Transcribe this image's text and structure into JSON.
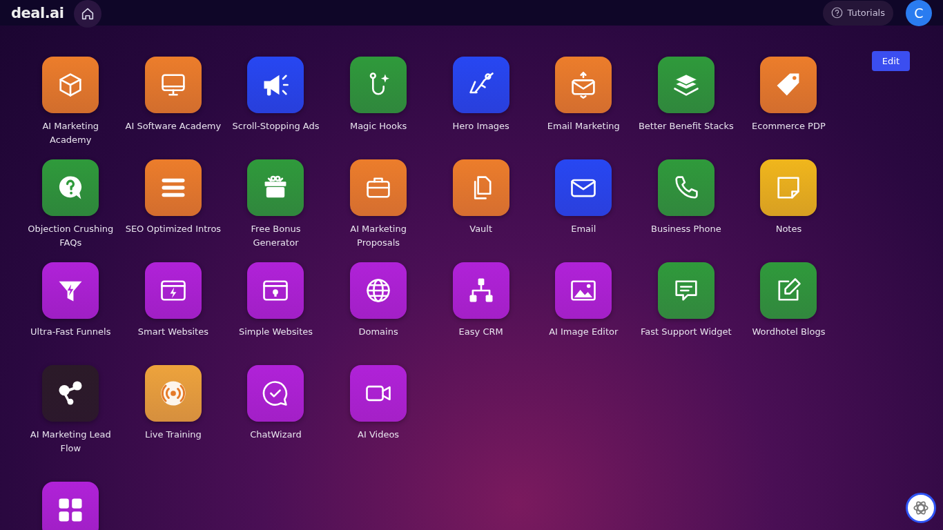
{
  "header": {
    "logo": "deal.ai",
    "tutorials": "Tutorials",
    "avatar_initial": "C"
  },
  "edit_button": "Edit",
  "apps": [
    {
      "label": "AI Marketing Academy",
      "color": "#ec7d2b",
      "kind": "cube"
    },
    {
      "label": "AI Software Academy",
      "color": "#ec7d2b",
      "kind": "monitor"
    },
    {
      "label": "Scroll-Stopping Ads",
      "color": "#2747f2",
      "kind": "megaphone"
    },
    {
      "label": "Magic Hooks",
      "color": "#2f9a3b",
      "kind": "hook"
    },
    {
      "label": "Hero Images",
      "color": "#2747f2",
      "kind": "hero"
    },
    {
      "label": "Email Marketing",
      "color": "#ec7d2b",
      "kind": "envelope-open"
    },
    {
      "label": "Better Benefit Stacks",
      "color": "#2f9a3b",
      "kind": "layers"
    },
    {
      "label": "Ecommerce PDP",
      "color": "#ec7d2b",
      "kind": "tag"
    },
    {
      "label": "Objection Crushing FAQs",
      "color": "#2f9a3b",
      "kind": "question"
    },
    {
      "label": "SEO Optimized Intros",
      "color": "#ec7d2b",
      "kind": "lines"
    },
    {
      "label": "Free Bonus Generator",
      "color": "#2f9a3b",
      "kind": "gift"
    },
    {
      "label": "AI Marketing Proposals",
      "color": "#ec7d2b",
      "kind": "briefcase"
    },
    {
      "label": "Vault",
      "color": "#ec7d2b",
      "kind": "documents"
    },
    {
      "label": "Email",
      "color": "#2747f2",
      "kind": "envelope"
    },
    {
      "label": "Business Phone",
      "color": "#2f9a3b",
      "kind": "phone"
    },
    {
      "label": "Notes",
      "color": "#f0b61c",
      "kind": "note"
    },
    {
      "label": "Ultra-Fast Funnels",
      "color": "#b022d8",
      "kind": "funnel"
    },
    {
      "label": "Smart Websites",
      "color": "#b022d8",
      "kind": "browser-bolt"
    },
    {
      "label": "Simple Websites",
      "color": "#b022d8",
      "kind": "browser-bulb"
    },
    {
      "label": "Domains",
      "color": "#b022d8",
      "kind": "globe"
    },
    {
      "label": "Easy CRM",
      "color": "#b022d8",
      "kind": "sitemap"
    },
    {
      "label": "AI Image Editor",
      "color": "#b022d8",
      "kind": "image"
    },
    {
      "label": "Fast Support Widget",
      "color": "#2f9a3b",
      "kind": "chat"
    },
    {
      "label": "Wordhotel Blogs",
      "color": "#2f9a3b",
      "kind": "pencil"
    },
    {
      "label": "AI Marketing Lead Flow",
      "color": "#2b1a28",
      "kind": "nodes"
    },
    {
      "label": "Live Training",
      "color": "#eda33c",
      "kind": "broadcast"
    },
    {
      "label": "ChatWizard",
      "color": "#b022d8",
      "kind": "chat-check"
    },
    {
      "label": "AI Videos",
      "color": "#b022d8",
      "kind": "video"
    },
    {
      "color": "#b022d8",
      "kind": "apps"
    }
  ]
}
